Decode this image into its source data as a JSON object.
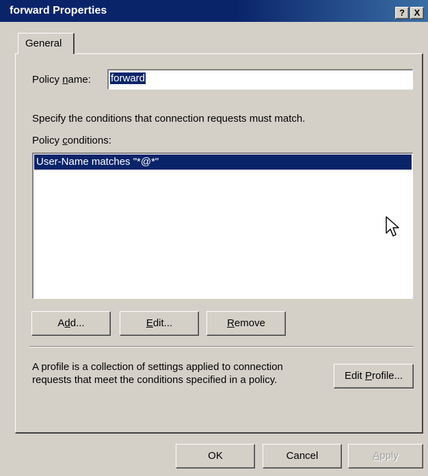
{
  "window": {
    "title": "forward Properties",
    "help_glyph": "?",
    "close_glyph": "X"
  },
  "tabs": [
    {
      "label": "General"
    }
  ],
  "general": {
    "policy_name_label": "Policy name:",
    "policy_name_value": "forward",
    "instructions": "Specify the conditions that connection requests must match.",
    "policy_conditions_label": "Policy conditions:",
    "conditions": [
      {
        "text": "User-Name matches \"*@*\"",
        "selected": true
      }
    ],
    "buttons": {
      "add": "Add...",
      "edit": "Edit...",
      "remove": "Remove"
    },
    "profile_description": "A profile is a collection of settings applied to connection requests that meet the conditions specified in a policy.",
    "edit_profile": "Edit Profile..."
  },
  "footer": {
    "ok": "OK",
    "cancel": "Cancel",
    "apply": "Apply",
    "apply_enabled": false
  },
  "colors": {
    "titlebar": "#0a246a",
    "dialog_face": "#d4d0c8",
    "selection": "#0a246a"
  },
  "icons": {
    "cursor": "mouse-pointer-icon"
  }
}
